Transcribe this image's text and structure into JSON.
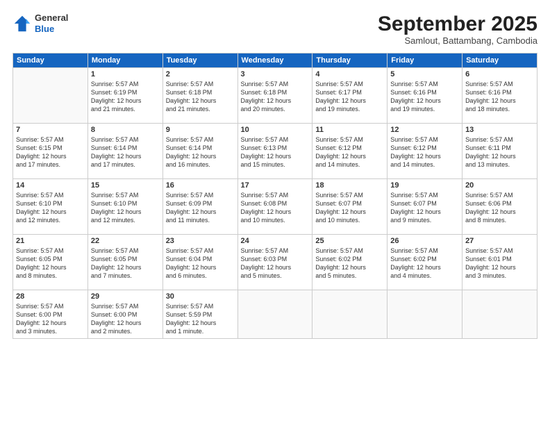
{
  "header": {
    "logo": {
      "general": "General",
      "blue": "Blue"
    },
    "title": "September 2025",
    "location": "Samlout, Battambang, Cambodia"
  },
  "days_of_week": [
    "Sunday",
    "Monday",
    "Tuesday",
    "Wednesday",
    "Thursday",
    "Friday",
    "Saturday"
  ],
  "weeks": [
    [
      {
        "day": "",
        "info": ""
      },
      {
        "day": "1",
        "info": "Sunrise: 5:57 AM\nSunset: 6:19 PM\nDaylight: 12 hours\nand 21 minutes."
      },
      {
        "day": "2",
        "info": "Sunrise: 5:57 AM\nSunset: 6:18 PM\nDaylight: 12 hours\nand 21 minutes."
      },
      {
        "day": "3",
        "info": "Sunrise: 5:57 AM\nSunset: 6:18 PM\nDaylight: 12 hours\nand 20 minutes."
      },
      {
        "day": "4",
        "info": "Sunrise: 5:57 AM\nSunset: 6:17 PM\nDaylight: 12 hours\nand 19 minutes."
      },
      {
        "day": "5",
        "info": "Sunrise: 5:57 AM\nSunset: 6:16 PM\nDaylight: 12 hours\nand 19 minutes."
      },
      {
        "day": "6",
        "info": "Sunrise: 5:57 AM\nSunset: 6:16 PM\nDaylight: 12 hours\nand 18 minutes."
      }
    ],
    [
      {
        "day": "7",
        "info": "Sunrise: 5:57 AM\nSunset: 6:15 PM\nDaylight: 12 hours\nand 17 minutes."
      },
      {
        "day": "8",
        "info": "Sunrise: 5:57 AM\nSunset: 6:14 PM\nDaylight: 12 hours\nand 17 minutes."
      },
      {
        "day": "9",
        "info": "Sunrise: 5:57 AM\nSunset: 6:14 PM\nDaylight: 12 hours\nand 16 minutes."
      },
      {
        "day": "10",
        "info": "Sunrise: 5:57 AM\nSunset: 6:13 PM\nDaylight: 12 hours\nand 15 minutes."
      },
      {
        "day": "11",
        "info": "Sunrise: 5:57 AM\nSunset: 6:12 PM\nDaylight: 12 hours\nand 14 minutes."
      },
      {
        "day": "12",
        "info": "Sunrise: 5:57 AM\nSunset: 6:12 PM\nDaylight: 12 hours\nand 14 minutes."
      },
      {
        "day": "13",
        "info": "Sunrise: 5:57 AM\nSunset: 6:11 PM\nDaylight: 12 hours\nand 13 minutes."
      }
    ],
    [
      {
        "day": "14",
        "info": "Sunrise: 5:57 AM\nSunset: 6:10 PM\nDaylight: 12 hours\nand 12 minutes."
      },
      {
        "day": "15",
        "info": "Sunrise: 5:57 AM\nSunset: 6:10 PM\nDaylight: 12 hours\nand 12 minutes."
      },
      {
        "day": "16",
        "info": "Sunrise: 5:57 AM\nSunset: 6:09 PM\nDaylight: 12 hours\nand 11 minutes."
      },
      {
        "day": "17",
        "info": "Sunrise: 5:57 AM\nSunset: 6:08 PM\nDaylight: 12 hours\nand 10 minutes."
      },
      {
        "day": "18",
        "info": "Sunrise: 5:57 AM\nSunset: 6:07 PM\nDaylight: 12 hours\nand 10 minutes."
      },
      {
        "day": "19",
        "info": "Sunrise: 5:57 AM\nSunset: 6:07 PM\nDaylight: 12 hours\nand 9 minutes."
      },
      {
        "day": "20",
        "info": "Sunrise: 5:57 AM\nSunset: 6:06 PM\nDaylight: 12 hours\nand 8 minutes."
      }
    ],
    [
      {
        "day": "21",
        "info": "Sunrise: 5:57 AM\nSunset: 6:05 PM\nDaylight: 12 hours\nand 8 minutes."
      },
      {
        "day": "22",
        "info": "Sunrise: 5:57 AM\nSunset: 6:05 PM\nDaylight: 12 hours\nand 7 minutes."
      },
      {
        "day": "23",
        "info": "Sunrise: 5:57 AM\nSunset: 6:04 PM\nDaylight: 12 hours\nand 6 minutes."
      },
      {
        "day": "24",
        "info": "Sunrise: 5:57 AM\nSunset: 6:03 PM\nDaylight: 12 hours\nand 5 minutes."
      },
      {
        "day": "25",
        "info": "Sunrise: 5:57 AM\nSunset: 6:02 PM\nDaylight: 12 hours\nand 5 minutes."
      },
      {
        "day": "26",
        "info": "Sunrise: 5:57 AM\nSunset: 6:02 PM\nDaylight: 12 hours\nand 4 minutes."
      },
      {
        "day": "27",
        "info": "Sunrise: 5:57 AM\nSunset: 6:01 PM\nDaylight: 12 hours\nand 3 minutes."
      }
    ],
    [
      {
        "day": "28",
        "info": "Sunrise: 5:57 AM\nSunset: 6:00 PM\nDaylight: 12 hours\nand 3 minutes."
      },
      {
        "day": "29",
        "info": "Sunrise: 5:57 AM\nSunset: 6:00 PM\nDaylight: 12 hours\nand 2 minutes."
      },
      {
        "day": "30",
        "info": "Sunrise: 5:57 AM\nSunset: 5:59 PM\nDaylight: 12 hours\nand 1 minute."
      },
      {
        "day": "",
        "info": ""
      },
      {
        "day": "",
        "info": ""
      },
      {
        "day": "",
        "info": ""
      },
      {
        "day": "",
        "info": ""
      }
    ]
  ]
}
